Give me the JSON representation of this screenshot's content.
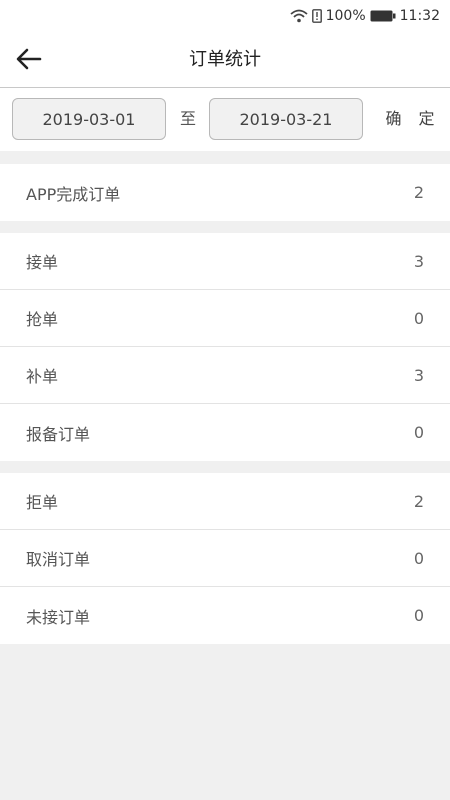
{
  "status": {
    "battery": "100%",
    "time": "11:32"
  },
  "header": {
    "title": "订单统计"
  },
  "filter": {
    "start_date": "2019-03-01",
    "separator": "至",
    "end_date": "2019-03-21",
    "confirm_label": "确 定"
  },
  "sections": [
    {
      "rows": [
        {
          "label": "APP完成订单",
          "value": "2"
        }
      ]
    },
    {
      "rows": [
        {
          "label": "接单",
          "value": "3"
        },
        {
          "label": "抢单",
          "value": "0"
        },
        {
          "label": "补单",
          "value": "3"
        },
        {
          "label": "报备订单",
          "value": "0"
        }
      ]
    },
    {
      "rows": [
        {
          "label": "拒单",
          "value": "2"
        },
        {
          "label": "取消订单",
          "value": "0"
        },
        {
          "label": "未接订单",
          "value": "0"
        }
      ]
    }
  ]
}
